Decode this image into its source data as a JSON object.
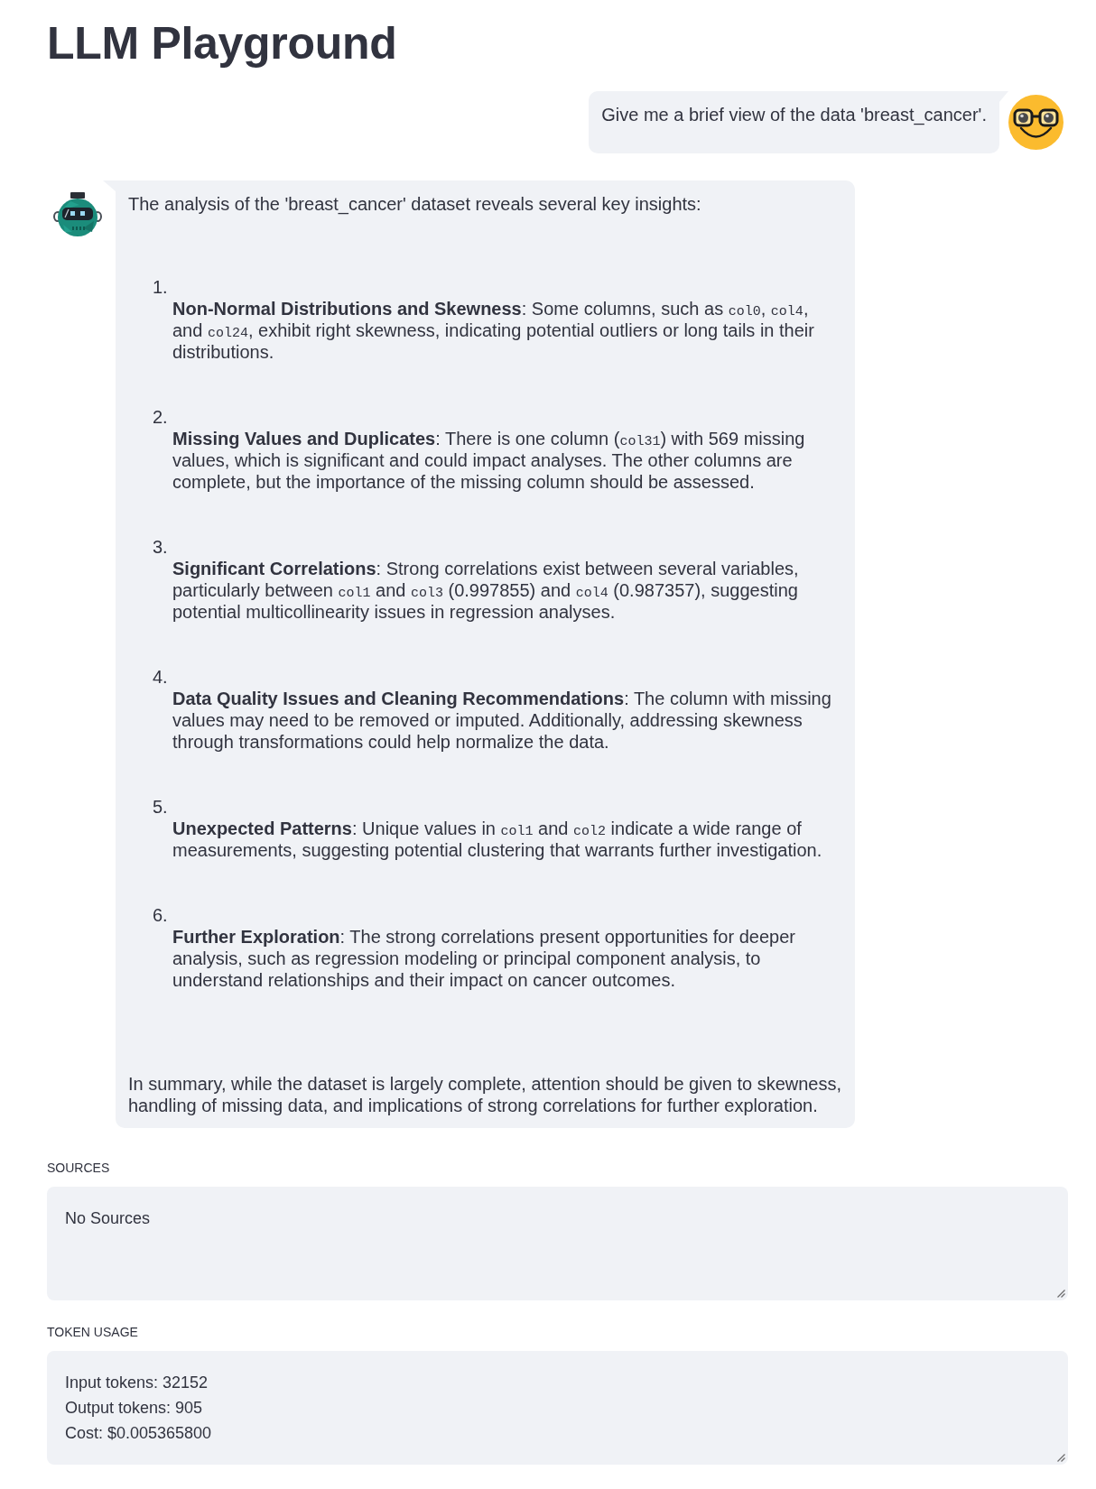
{
  "title": "LLM Playground",
  "messages": [
    {
      "kind": "user",
      "text": "Give me a brief view of the data 'breast_cancer'."
    },
    {
      "kind": "assistant",
      "intro": "The analysis of the 'breast_cancer' dataset reveals several key insights:",
      "items": [
        {
          "number": "1.",
          "parts": [
            {
              "kind": "bold",
              "text": "Non-Normal Distributions and Skewness"
            },
            {
              "kind": "text",
              "text": ": Some columns, such as "
            },
            {
              "kind": "code",
              "text": "col0"
            },
            {
              "kind": "text",
              "text": ", "
            },
            {
              "kind": "code",
              "text": "col4"
            },
            {
              "kind": "text",
              "text": ", and "
            },
            {
              "kind": "code",
              "text": "col24"
            },
            {
              "kind": "text",
              "text": ", exhibit right skewness, indicating potential outliers or long tails in their distributions."
            }
          ]
        },
        {
          "number": "2.",
          "parts": [
            {
              "kind": "bold",
              "text": "Missing Values and Duplicates"
            },
            {
              "kind": "text",
              "text": ": There is one column ("
            },
            {
              "kind": "code",
              "text": "col31"
            },
            {
              "kind": "text",
              "text": ") with 569 missing values, which is significant and could impact analyses. The other columns are complete, but the importance of the missing column should be assessed."
            }
          ]
        },
        {
          "number": "3.",
          "parts": [
            {
              "kind": "bold",
              "text": "Significant Correlations"
            },
            {
              "kind": "text",
              "text": ": Strong correlations exist between several variables, particularly between "
            },
            {
              "kind": "code",
              "text": "col1"
            },
            {
              "kind": "text",
              "text": " and "
            },
            {
              "kind": "code",
              "text": "col3"
            },
            {
              "kind": "text",
              "text": " (0.997855) and "
            },
            {
              "kind": "code",
              "text": "col4"
            },
            {
              "kind": "text",
              "text": " (0.987357), suggesting potential multicollinearity issues in regression analyses."
            }
          ]
        },
        {
          "number": "4.",
          "parts": [
            {
              "kind": "bold",
              "text": "Data Quality Issues and Cleaning Recommendations"
            },
            {
              "kind": "text",
              "text": ": The column with missing values may need to be removed or imputed. Additionally, addressing skewness through transformations could help normalize the data."
            }
          ]
        },
        {
          "number": "5.",
          "parts": [
            {
              "kind": "bold",
              "text": "Unexpected Patterns"
            },
            {
              "kind": "text",
              "text": ": Unique values in "
            },
            {
              "kind": "code",
              "text": "col1"
            },
            {
              "kind": "text",
              "text": " and "
            },
            {
              "kind": "code",
              "text": "col2"
            },
            {
              "kind": "text",
              "text": " indicate a wide range of measurements, suggesting potential clustering that warrants further investigation."
            }
          ]
        },
        {
          "number": "6.",
          "parts": [
            {
              "kind": "bold",
              "text": "Further Exploration"
            },
            {
              "kind": "text",
              "text": ": The strong correlations present opportunities for deeper analysis, such as regression modeling or principal component analysis, to understand relationships and their impact on cancer outcomes."
            }
          ]
        }
      ],
      "summary": "In summary, while the dataset is largely complete, attention should be given to skewness, handling of missing data, and implications of strong correlations for further exploration."
    }
  ],
  "sources": {
    "label": "SOURCES",
    "value": "No Sources"
  },
  "token_usage": {
    "label": "TOKEN USAGE",
    "value": "Input tokens: 32152\nOutput tokens: 905\nCost: $0.005365800"
  }
}
